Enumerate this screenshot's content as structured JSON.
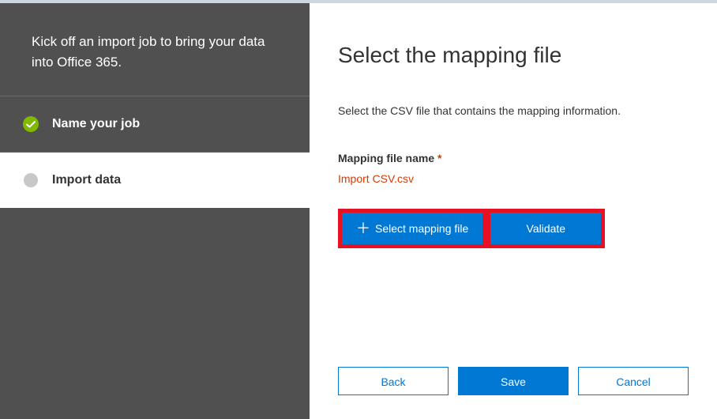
{
  "sidebar": {
    "intro": "Kick off an import job to bring your data into Office 365.",
    "steps": [
      {
        "label": "Name your job",
        "status": "completed"
      },
      {
        "label": "Import data",
        "status": "current"
      }
    ]
  },
  "main": {
    "title": "Select the mapping file",
    "description": "Select the CSV file that contains the mapping information.",
    "field_label": "Mapping file name",
    "required_mark": "*",
    "file_name": "Import CSV.csv",
    "select_button": "Select mapping file",
    "validate_button": "Validate"
  },
  "footer": {
    "back": "Back",
    "save": "Save",
    "cancel": "Cancel"
  }
}
